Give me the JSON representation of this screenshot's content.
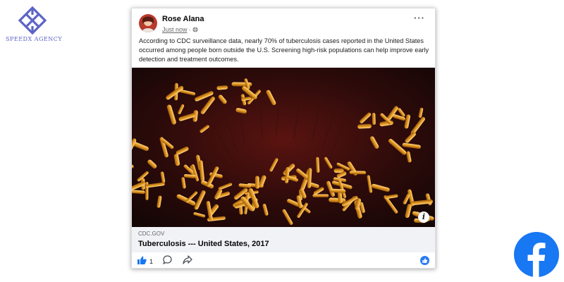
{
  "agency": {
    "name": "SPEEDX AGENCY",
    "logo_color": "#5c64c6"
  },
  "post": {
    "author": "Rose Alana",
    "timestamp": "Just now",
    "separator": "·",
    "privacy_icon": "globe-icon",
    "more_label": "···",
    "text": "According to CDC surveillance data, nearly 70% of tuberculosis cases reported in the United States occurred among people born outside the U.S. Screening high-risk populations can help improve early detection and treatment outcomes.",
    "image_info_label": "i",
    "link": {
      "domain": "CDC.GOV",
      "title": "Tuberculosis --- United States, 2017"
    },
    "actions": {
      "like_icon": "thumbs-up-icon",
      "like_count": "1",
      "comment_icon": "comment-icon",
      "share_icon": "share-icon",
      "reaction_icon": "like-reaction-icon"
    }
  },
  "brand": {
    "facebook_logo": "facebook-logo-icon",
    "facebook_blue": "#1877f2",
    "like_blue": "#2a7cf3"
  }
}
